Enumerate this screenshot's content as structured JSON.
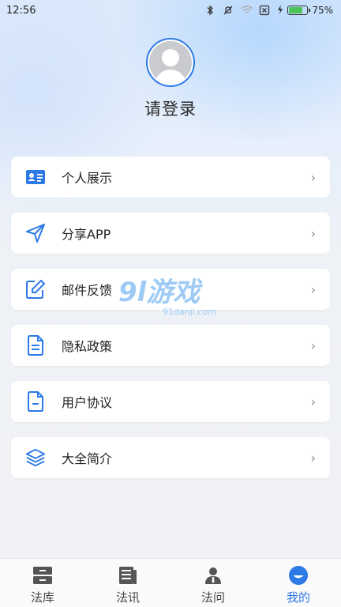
{
  "status_bar": {
    "time": "12:56",
    "battery_percent": "75%",
    "battery_level": 0.75,
    "icons": [
      "bluetooth-icon",
      "mute-icon",
      "wifi-icon",
      "sim-icon",
      "charging-icon"
    ]
  },
  "profile": {
    "login_prompt": "请登录"
  },
  "menu": {
    "items": [
      {
        "label": "个人展示",
        "icon": "id-card-icon"
      },
      {
        "label": "分享APP",
        "icon": "send-icon"
      },
      {
        "label": "邮件反馈",
        "icon": "edit-icon"
      },
      {
        "label": "隐私政策",
        "icon": "document-icon"
      },
      {
        "label": "用户协议",
        "icon": "agreement-icon"
      },
      {
        "label": "大全简介",
        "icon": "layers-icon"
      }
    ]
  },
  "watermark": {
    "main": "9l游戏",
    "sub": "91danji.com"
  },
  "tabbar": {
    "tabs": [
      {
        "label": "法库",
        "icon": "library-icon",
        "active": false
      },
      {
        "label": "法讯",
        "icon": "news-icon",
        "active": false
      },
      {
        "label": "法问",
        "icon": "lawyer-icon",
        "active": false
      },
      {
        "label": "我的",
        "icon": "profile-icon",
        "active": true
      }
    ]
  },
  "colors": {
    "accent": "#2d7ae6",
    "icon_blue": "#2d7ae6",
    "text": "#222222"
  }
}
